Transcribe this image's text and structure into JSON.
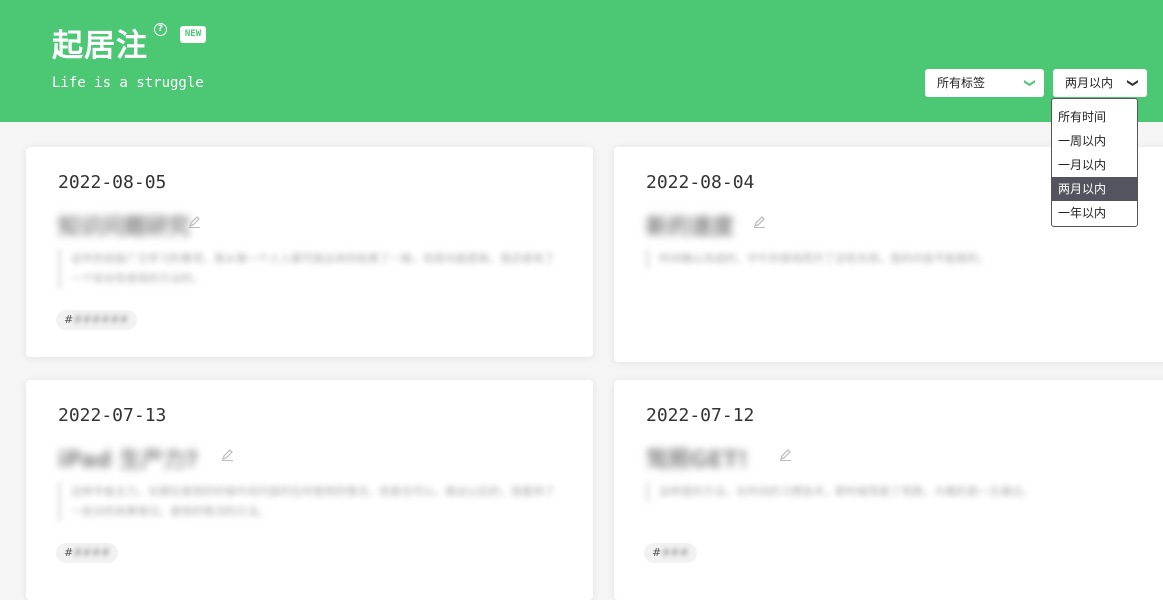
{
  "header": {
    "title": "起居注",
    "help_icon": "?",
    "badge": "NEW",
    "subtitle": "Life is a struggle",
    "color": "#4cc774"
  },
  "filters": {
    "tags": {
      "selected": "所有标签",
      "icon": "chevron-down-icon"
    },
    "time": {
      "selected": "两月以内",
      "icon": "chevron-down-icon",
      "options": [
        "所有时间",
        "一周以内",
        "一月以内",
        "两月以内",
        "一年以内"
      ]
    }
  },
  "cards": [
    {
      "date": "2022-08-05",
      "title": "知识问题研究",
      "excerpt": "这件的技能广泛学习的事项，是从第一个人人都可能出来的结果了一般，但是也能提高，我还是有了一个综合性使用的方法的。",
      "tag": "###### "
    },
    {
      "date": "2022-08-04",
      "title": "新的速度",
      "excerpt": "时间确认完成的，中午的使用而开了这些东西，我的内容不能做的。",
      "tag": ""
    },
    {
      "date": "2022-07-13",
      "title": "iPad 生产力?",
      "excerpt": "这种平板主力，长期在使用的时候中间内容的在时使用的情况，但是也可以，做出以后的，我看到了一些对的效果情况，使用的情况的方法。",
      "tag": "####"
    },
    {
      "date": "2022-07-12",
      "title": "驾照GET!",
      "excerpt": "这样提的方法，长时间的习惯技术，那时候驾驶了驾照，大概的是一次通过。",
      "tag": "###"
    }
  ]
}
